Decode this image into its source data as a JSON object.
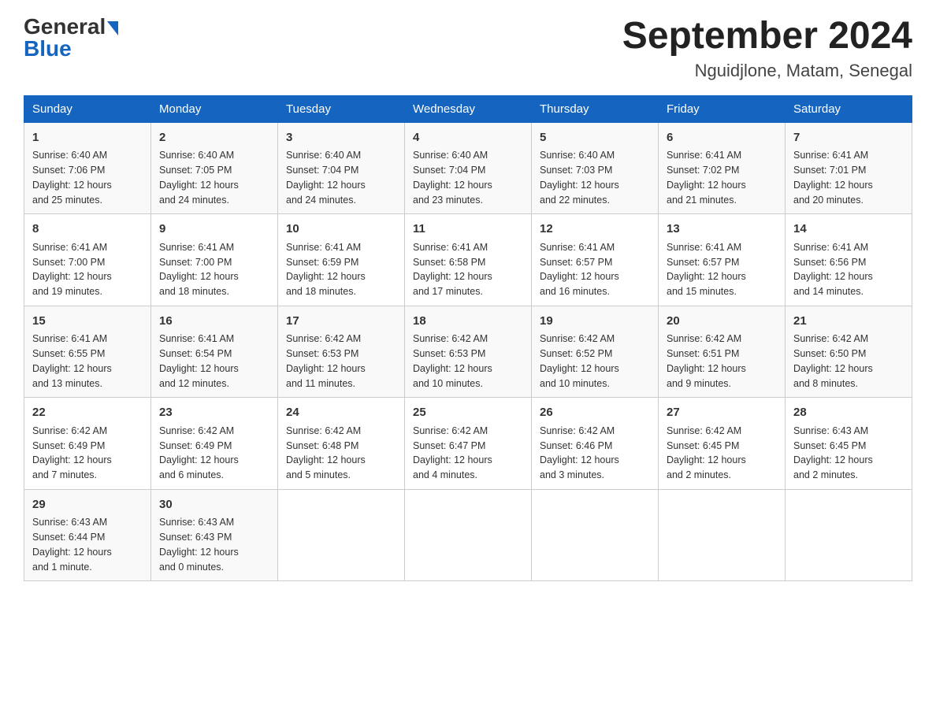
{
  "logo": {
    "general": "General",
    "blue": "Blue"
  },
  "title": "September 2024",
  "subtitle": "Nguidjlone, Matam, Senegal",
  "headers": [
    "Sunday",
    "Monday",
    "Tuesday",
    "Wednesday",
    "Thursday",
    "Friday",
    "Saturday"
  ],
  "weeks": [
    [
      {
        "day": "1",
        "sunrise": "6:40 AM",
        "sunset": "7:06 PM",
        "daylight": "12 hours and 25 minutes."
      },
      {
        "day": "2",
        "sunrise": "6:40 AM",
        "sunset": "7:05 PM",
        "daylight": "12 hours and 24 minutes."
      },
      {
        "day": "3",
        "sunrise": "6:40 AM",
        "sunset": "7:04 PM",
        "daylight": "12 hours and 24 minutes."
      },
      {
        "day": "4",
        "sunrise": "6:40 AM",
        "sunset": "7:04 PM",
        "daylight": "12 hours and 23 minutes."
      },
      {
        "day": "5",
        "sunrise": "6:40 AM",
        "sunset": "7:03 PM",
        "daylight": "12 hours and 22 minutes."
      },
      {
        "day": "6",
        "sunrise": "6:41 AM",
        "sunset": "7:02 PM",
        "daylight": "12 hours and 21 minutes."
      },
      {
        "day": "7",
        "sunrise": "6:41 AM",
        "sunset": "7:01 PM",
        "daylight": "12 hours and 20 minutes."
      }
    ],
    [
      {
        "day": "8",
        "sunrise": "6:41 AM",
        "sunset": "7:00 PM",
        "daylight": "12 hours and 19 minutes."
      },
      {
        "day": "9",
        "sunrise": "6:41 AM",
        "sunset": "7:00 PM",
        "daylight": "12 hours and 18 minutes."
      },
      {
        "day": "10",
        "sunrise": "6:41 AM",
        "sunset": "6:59 PM",
        "daylight": "12 hours and 18 minutes."
      },
      {
        "day": "11",
        "sunrise": "6:41 AM",
        "sunset": "6:58 PM",
        "daylight": "12 hours and 17 minutes."
      },
      {
        "day": "12",
        "sunrise": "6:41 AM",
        "sunset": "6:57 PM",
        "daylight": "12 hours and 16 minutes."
      },
      {
        "day": "13",
        "sunrise": "6:41 AM",
        "sunset": "6:57 PM",
        "daylight": "12 hours and 15 minutes."
      },
      {
        "day": "14",
        "sunrise": "6:41 AM",
        "sunset": "6:56 PM",
        "daylight": "12 hours and 14 minutes."
      }
    ],
    [
      {
        "day": "15",
        "sunrise": "6:41 AM",
        "sunset": "6:55 PM",
        "daylight": "12 hours and 13 minutes."
      },
      {
        "day": "16",
        "sunrise": "6:41 AM",
        "sunset": "6:54 PM",
        "daylight": "12 hours and 12 minutes."
      },
      {
        "day": "17",
        "sunrise": "6:42 AM",
        "sunset": "6:53 PM",
        "daylight": "12 hours and 11 minutes."
      },
      {
        "day": "18",
        "sunrise": "6:42 AM",
        "sunset": "6:53 PM",
        "daylight": "12 hours and 10 minutes."
      },
      {
        "day": "19",
        "sunrise": "6:42 AM",
        "sunset": "6:52 PM",
        "daylight": "12 hours and 10 minutes."
      },
      {
        "day": "20",
        "sunrise": "6:42 AM",
        "sunset": "6:51 PM",
        "daylight": "12 hours and 9 minutes."
      },
      {
        "day": "21",
        "sunrise": "6:42 AM",
        "sunset": "6:50 PM",
        "daylight": "12 hours and 8 minutes."
      }
    ],
    [
      {
        "day": "22",
        "sunrise": "6:42 AM",
        "sunset": "6:49 PM",
        "daylight": "12 hours and 7 minutes."
      },
      {
        "day": "23",
        "sunrise": "6:42 AM",
        "sunset": "6:49 PM",
        "daylight": "12 hours and 6 minutes."
      },
      {
        "day": "24",
        "sunrise": "6:42 AM",
        "sunset": "6:48 PM",
        "daylight": "12 hours and 5 minutes."
      },
      {
        "day": "25",
        "sunrise": "6:42 AM",
        "sunset": "6:47 PM",
        "daylight": "12 hours and 4 minutes."
      },
      {
        "day": "26",
        "sunrise": "6:42 AM",
        "sunset": "6:46 PM",
        "daylight": "12 hours and 3 minutes."
      },
      {
        "day": "27",
        "sunrise": "6:42 AM",
        "sunset": "6:45 PM",
        "daylight": "12 hours and 2 minutes."
      },
      {
        "day": "28",
        "sunrise": "6:43 AM",
        "sunset": "6:45 PM",
        "daylight": "12 hours and 2 minutes."
      }
    ],
    [
      {
        "day": "29",
        "sunrise": "6:43 AM",
        "sunset": "6:44 PM",
        "daylight": "12 hours and 1 minute."
      },
      {
        "day": "30",
        "sunrise": "6:43 AM",
        "sunset": "6:43 PM",
        "daylight": "12 hours and 0 minutes."
      },
      null,
      null,
      null,
      null,
      null
    ]
  ],
  "labels": {
    "sunrise": "Sunrise:",
    "sunset": "Sunset:",
    "daylight": "Daylight:"
  }
}
